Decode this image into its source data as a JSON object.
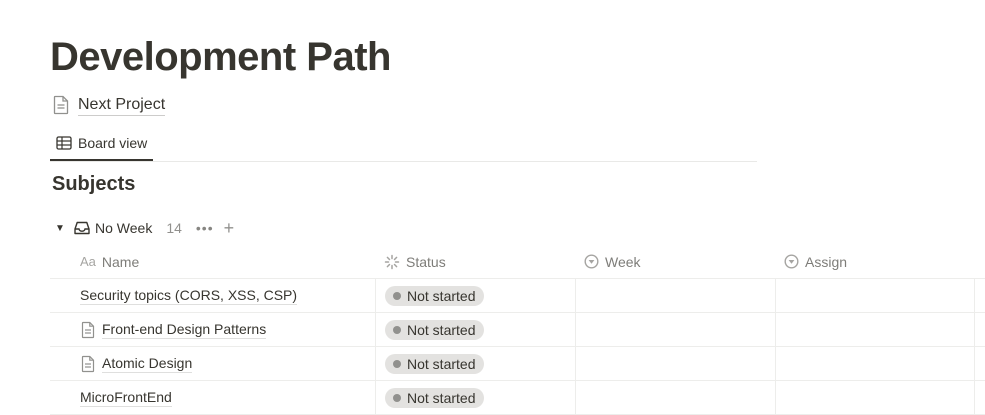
{
  "page": {
    "title": "Development Path"
  },
  "linked_page": {
    "icon": "document-icon",
    "label": "Next Project"
  },
  "tabs": [
    {
      "label": "Board view",
      "icon": "table-icon",
      "active": true
    }
  ],
  "database": {
    "title": "Subjects"
  },
  "group": {
    "toggle": "▼",
    "icon": "inbox-icon",
    "name": "No Week",
    "count": "14",
    "more": "•••",
    "add": "+"
  },
  "columns": {
    "name": {
      "label": "Name",
      "icon_text": "Aa"
    },
    "status": {
      "label": "Status",
      "icon": "status-icon"
    },
    "week": {
      "label": "Week",
      "icon": "select-icon"
    },
    "assign": {
      "label": "Assign",
      "icon": "select-icon"
    }
  },
  "rows": [
    {
      "name": "Security topics (CORS, XSS, CSP)",
      "has_icon": false,
      "status": "Not started",
      "week": "",
      "assign": ""
    },
    {
      "name": "Front-end Design Patterns",
      "has_icon": true,
      "status": "Not started",
      "week": "",
      "assign": ""
    },
    {
      "name": "Atomic Design",
      "has_icon": true,
      "status": "Not started",
      "week": "",
      "assign": ""
    },
    {
      "name": "MicroFrontEnd",
      "has_icon": false,
      "status": "Not started",
      "week": "",
      "assign": ""
    }
  ],
  "colors": {
    "text": "#37352f",
    "pill_bg": "#e3e2e0",
    "pill_dot": "#91918e",
    "divider": "#ededeb"
  }
}
